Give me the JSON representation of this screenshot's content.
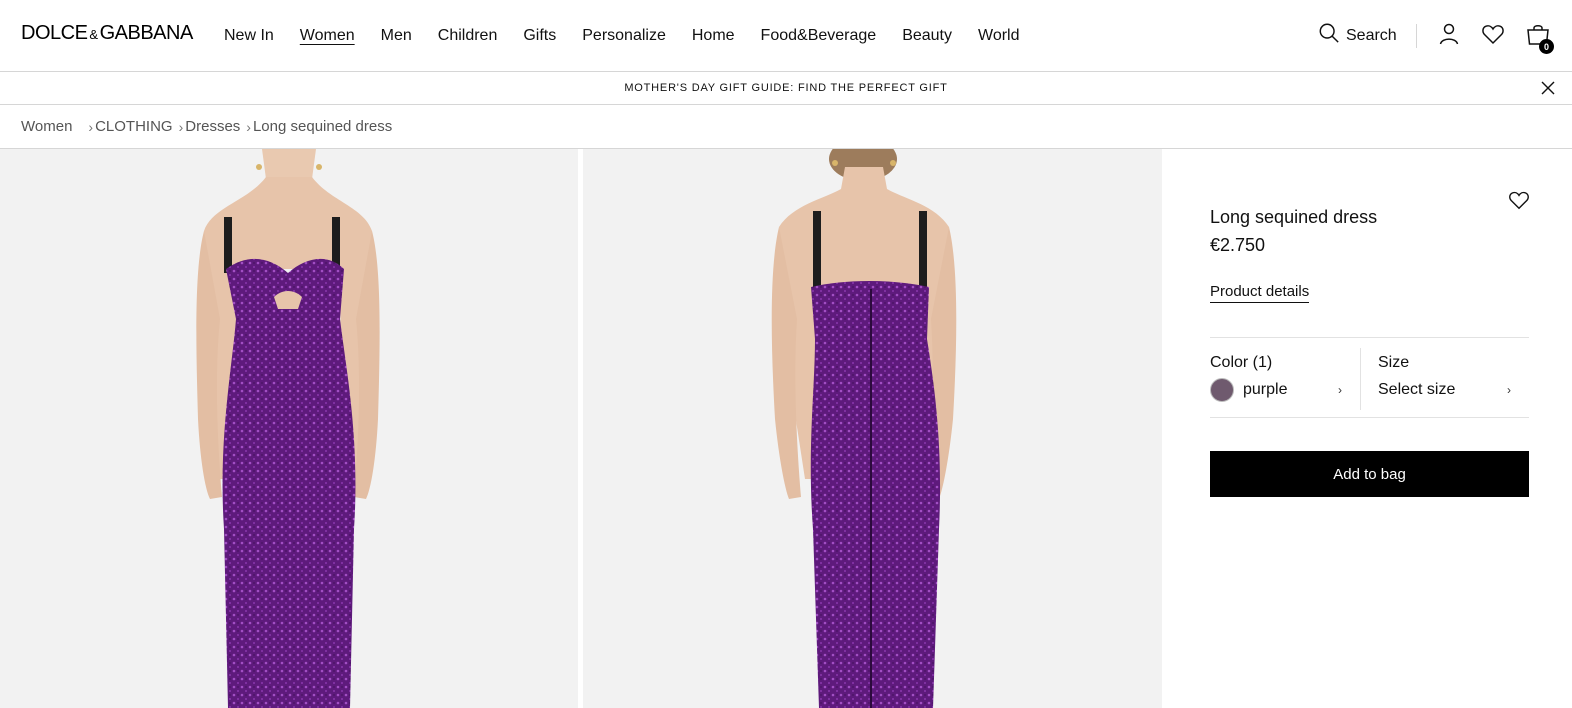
{
  "header": {
    "logo": {
      "left": "DOLCE",
      "amp": "&",
      "right": "GABBANA"
    },
    "nav": [
      "New In",
      "Women",
      "Men",
      "Children",
      "Gifts",
      "Personalize",
      "Home",
      "Food&Beverage",
      "Beauty",
      "World"
    ],
    "active_nav": "Women",
    "search_label": "Search",
    "cart_count": "0"
  },
  "promo": {
    "text": "MOTHER'S DAY GIFT GUIDE: FIND THE PERFECT GIFT"
  },
  "breadcrumb": {
    "items": [
      "Women",
      "CLOTHING",
      "Dresses",
      "Long sequined dress"
    ],
    "separator": "›"
  },
  "product": {
    "title": "Long sequined dress",
    "price": "€2.750",
    "details_link": "Product details",
    "color_label": "Color (1)",
    "color_value": "purple",
    "color_hex": "#6f5a6e",
    "size_label": "Size",
    "size_value": "Select size",
    "chevron": "›",
    "add_to_bag": "Add to bag"
  },
  "colors": {
    "dress": "#6a1f8a",
    "background": "#f2f2f2",
    "button": "#000000"
  }
}
